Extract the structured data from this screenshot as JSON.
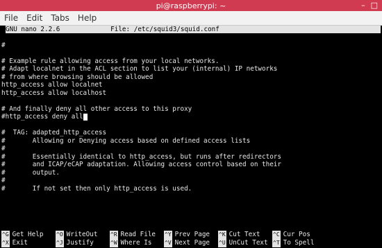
{
  "window": {
    "title": "pi@raspberrypi: ~",
    "minimize": "–",
    "maximize": "□"
  },
  "menu": [
    "File",
    "Edit",
    "Tabs",
    "Help"
  ],
  "nano": {
    "version": "GNU nano 2.2.6",
    "file": "File: /etc/squid3/squid.conf"
  },
  "lines": [
    "",
    "#",
    "",
    "# Example rule allowing access from your local networks.",
    "# Adapt localnet in the ACL section to list your (internal) IP networks",
    "# from where browsing should be allowed",
    "http_access allow localnet",
    "http_access allow localhost",
    "",
    "# And finally deny all other access to this proxy",
    "#http_access deny all",
    "",
    "#  TAG: adapted_http_access",
    "#       Allowing or Denying access based on defined access lists",
    "#",
    "#       Essentially identical to http_access, but runs after redirectors",
    "#       and ICAP/eCAP adaptation. Allowing access control based on their",
    "#       output.",
    "#",
    "#       If not set then only http_access is used."
  ],
  "shortcuts": [
    [
      {
        "key": "^G",
        "label": "Get Help"
      },
      {
        "key": "^O",
        "label": "WriteOut"
      },
      {
        "key": "^R",
        "label": "Read File"
      },
      {
        "key": "^Y",
        "label": "Prev Page"
      },
      {
        "key": "^K",
        "label": "Cut Text"
      },
      {
        "key": "^C",
        "label": "Cur Pos"
      }
    ],
    [
      {
        "key": "^X",
        "label": "Exit"
      },
      {
        "key": "^J",
        "label": "Justify"
      },
      {
        "key": "^W",
        "label": "Where Is"
      },
      {
        "key": "^V",
        "label": "Next Page"
      },
      {
        "key": "^U",
        "label": "UnCut Text"
      },
      {
        "key": "^T",
        "label": "To Spell"
      }
    ]
  ]
}
